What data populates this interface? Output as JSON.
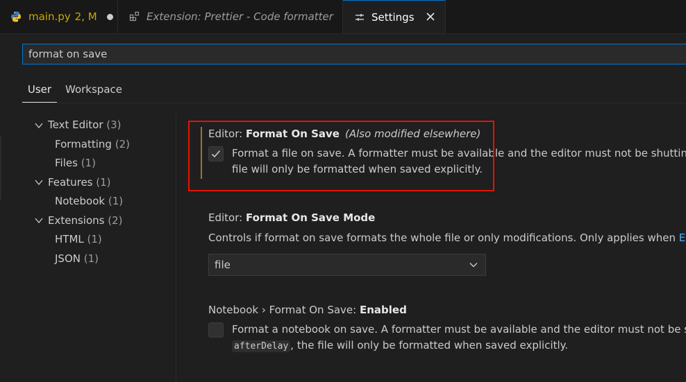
{
  "tabs": [
    {
      "label": "main.py",
      "badge": "2, M",
      "icon": "python-icon"
    },
    {
      "label": "Extension: Prettier - Code formatter",
      "icon": "extensions-icon"
    },
    {
      "label": "Settings",
      "icon": "settings-sliders-icon"
    }
  ],
  "search": {
    "value": "format on save"
  },
  "scope_tabs": [
    "User",
    "Workspace"
  ],
  "toc": [
    {
      "label": "Text Editor",
      "count": "(3)",
      "expanded": true
    },
    {
      "label": "Formatting",
      "count": "(2)"
    },
    {
      "label": "Files",
      "count": "(1)"
    },
    {
      "label": "Features",
      "count": "(1)",
      "expanded": true
    },
    {
      "label": "Notebook",
      "count": "(1)"
    },
    {
      "label": "Extensions",
      "count": "(2)",
      "expanded": true
    },
    {
      "label": "HTML",
      "count": "(1)"
    },
    {
      "label": "JSON",
      "count": "(1)"
    }
  ],
  "settings": [
    {
      "category": "Editor: ",
      "name": "Format On Save",
      "note": "(Also modified elsewhere)",
      "checked": true,
      "desc_line1": "Format a file on save. A formatter must be available and the editor must not be shutting dow",
      "desc_line2": "file will only be formatted when saved explicitly."
    },
    {
      "category": "Editor: ",
      "name": "Format On Save Mode",
      "desc_prefix": "Controls if format on save formats the whole file or only modifications. Only applies when ",
      "desc_link": "Editor",
      "select_value": "file"
    },
    {
      "category": "Notebook › Format On Save: ",
      "name": "Enabled",
      "checked": false,
      "desc_line1": "Format a notebook on save. A formatter must be available and the editor must not be shutt",
      "desc_code": "afterDelay",
      "desc_line2_suffix": ", the file will only be formatted when saved explicitly."
    }
  ],
  "colors": {
    "accent": "#0078d4",
    "modified_tab": "#cca700",
    "highlight_box": "#e51400",
    "link": "#4daafc"
  }
}
